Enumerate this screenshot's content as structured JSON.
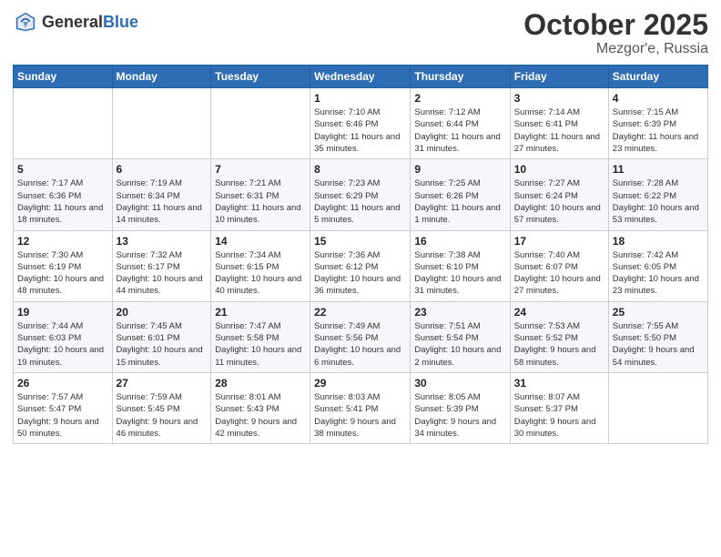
{
  "header": {
    "logo_general": "General",
    "logo_blue": "Blue",
    "month": "October 2025",
    "location": "Mezgor'e, Russia"
  },
  "weekdays": [
    "Sunday",
    "Monday",
    "Tuesday",
    "Wednesday",
    "Thursday",
    "Friday",
    "Saturday"
  ],
  "weeks": [
    [
      {
        "day": "",
        "sunrise": "",
        "sunset": "",
        "daylight": ""
      },
      {
        "day": "",
        "sunrise": "",
        "sunset": "",
        "daylight": ""
      },
      {
        "day": "",
        "sunrise": "",
        "sunset": "",
        "daylight": ""
      },
      {
        "day": "1",
        "sunrise": "Sunrise: 7:10 AM",
        "sunset": "Sunset: 6:46 PM",
        "daylight": "Daylight: 11 hours and 35 minutes."
      },
      {
        "day": "2",
        "sunrise": "Sunrise: 7:12 AM",
        "sunset": "Sunset: 6:44 PM",
        "daylight": "Daylight: 11 hours and 31 minutes."
      },
      {
        "day": "3",
        "sunrise": "Sunrise: 7:14 AM",
        "sunset": "Sunset: 6:41 PM",
        "daylight": "Daylight: 11 hours and 27 minutes."
      },
      {
        "day": "4",
        "sunrise": "Sunrise: 7:15 AM",
        "sunset": "Sunset: 6:39 PM",
        "daylight": "Daylight: 11 hours and 23 minutes."
      }
    ],
    [
      {
        "day": "5",
        "sunrise": "Sunrise: 7:17 AM",
        "sunset": "Sunset: 6:36 PM",
        "daylight": "Daylight: 11 hours and 18 minutes."
      },
      {
        "day": "6",
        "sunrise": "Sunrise: 7:19 AM",
        "sunset": "Sunset: 6:34 PM",
        "daylight": "Daylight: 11 hours and 14 minutes."
      },
      {
        "day": "7",
        "sunrise": "Sunrise: 7:21 AM",
        "sunset": "Sunset: 6:31 PM",
        "daylight": "Daylight: 11 hours and 10 minutes."
      },
      {
        "day": "8",
        "sunrise": "Sunrise: 7:23 AM",
        "sunset": "Sunset: 6:29 PM",
        "daylight": "Daylight: 11 hours and 5 minutes."
      },
      {
        "day": "9",
        "sunrise": "Sunrise: 7:25 AM",
        "sunset": "Sunset: 6:26 PM",
        "daylight": "Daylight: 11 hours and 1 minute."
      },
      {
        "day": "10",
        "sunrise": "Sunrise: 7:27 AM",
        "sunset": "Sunset: 6:24 PM",
        "daylight": "Daylight: 10 hours and 57 minutes."
      },
      {
        "day": "11",
        "sunrise": "Sunrise: 7:28 AM",
        "sunset": "Sunset: 6:22 PM",
        "daylight": "Daylight: 10 hours and 53 minutes."
      }
    ],
    [
      {
        "day": "12",
        "sunrise": "Sunrise: 7:30 AM",
        "sunset": "Sunset: 6:19 PM",
        "daylight": "Daylight: 10 hours and 48 minutes."
      },
      {
        "day": "13",
        "sunrise": "Sunrise: 7:32 AM",
        "sunset": "Sunset: 6:17 PM",
        "daylight": "Daylight: 10 hours and 44 minutes."
      },
      {
        "day": "14",
        "sunrise": "Sunrise: 7:34 AM",
        "sunset": "Sunset: 6:15 PM",
        "daylight": "Daylight: 10 hours and 40 minutes."
      },
      {
        "day": "15",
        "sunrise": "Sunrise: 7:36 AM",
        "sunset": "Sunset: 6:12 PM",
        "daylight": "Daylight: 10 hours and 36 minutes."
      },
      {
        "day": "16",
        "sunrise": "Sunrise: 7:38 AM",
        "sunset": "Sunset: 6:10 PM",
        "daylight": "Daylight: 10 hours and 31 minutes."
      },
      {
        "day": "17",
        "sunrise": "Sunrise: 7:40 AM",
        "sunset": "Sunset: 6:07 PM",
        "daylight": "Daylight: 10 hours and 27 minutes."
      },
      {
        "day": "18",
        "sunrise": "Sunrise: 7:42 AM",
        "sunset": "Sunset: 6:05 PM",
        "daylight": "Daylight: 10 hours and 23 minutes."
      }
    ],
    [
      {
        "day": "19",
        "sunrise": "Sunrise: 7:44 AM",
        "sunset": "Sunset: 6:03 PM",
        "daylight": "Daylight: 10 hours and 19 minutes."
      },
      {
        "day": "20",
        "sunrise": "Sunrise: 7:45 AM",
        "sunset": "Sunset: 6:01 PM",
        "daylight": "Daylight: 10 hours and 15 minutes."
      },
      {
        "day": "21",
        "sunrise": "Sunrise: 7:47 AM",
        "sunset": "Sunset: 5:58 PM",
        "daylight": "Daylight: 10 hours and 11 minutes."
      },
      {
        "day": "22",
        "sunrise": "Sunrise: 7:49 AM",
        "sunset": "Sunset: 5:56 PM",
        "daylight": "Daylight: 10 hours and 6 minutes."
      },
      {
        "day": "23",
        "sunrise": "Sunrise: 7:51 AM",
        "sunset": "Sunset: 5:54 PM",
        "daylight": "Daylight: 10 hours and 2 minutes."
      },
      {
        "day": "24",
        "sunrise": "Sunrise: 7:53 AM",
        "sunset": "Sunset: 5:52 PM",
        "daylight": "Daylight: 9 hours and 58 minutes."
      },
      {
        "day": "25",
        "sunrise": "Sunrise: 7:55 AM",
        "sunset": "Sunset: 5:50 PM",
        "daylight": "Daylight: 9 hours and 54 minutes."
      }
    ],
    [
      {
        "day": "26",
        "sunrise": "Sunrise: 7:57 AM",
        "sunset": "Sunset: 5:47 PM",
        "daylight": "Daylight: 9 hours and 50 minutes."
      },
      {
        "day": "27",
        "sunrise": "Sunrise: 7:59 AM",
        "sunset": "Sunset: 5:45 PM",
        "daylight": "Daylight: 9 hours and 46 minutes."
      },
      {
        "day": "28",
        "sunrise": "Sunrise: 8:01 AM",
        "sunset": "Sunset: 5:43 PM",
        "daylight": "Daylight: 9 hours and 42 minutes."
      },
      {
        "day": "29",
        "sunrise": "Sunrise: 8:03 AM",
        "sunset": "Sunset: 5:41 PM",
        "daylight": "Daylight: 9 hours and 38 minutes."
      },
      {
        "day": "30",
        "sunrise": "Sunrise: 8:05 AM",
        "sunset": "Sunset: 5:39 PM",
        "daylight": "Daylight: 9 hours and 34 minutes."
      },
      {
        "day": "31",
        "sunrise": "Sunrise: 8:07 AM",
        "sunset": "Sunset: 5:37 PM",
        "daylight": "Daylight: 9 hours and 30 minutes."
      },
      {
        "day": "",
        "sunrise": "",
        "sunset": "",
        "daylight": ""
      }
    ]
  ]
}
